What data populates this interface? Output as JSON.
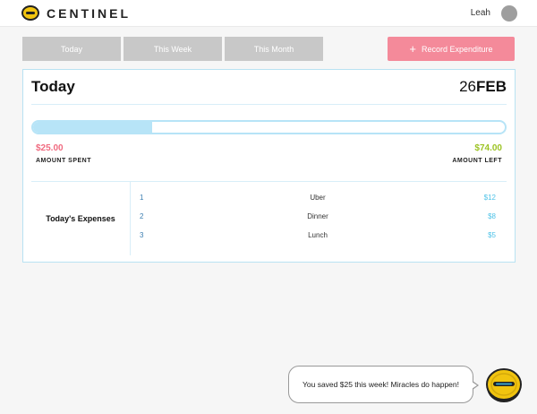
{
  "header": {
    "brand": "CENTINEL",
    "username": "Leah",
    "logo_icon": "coin-icon",
    "avatar_color": "#9e9e9e"
  },
  "tabs": [
    {
      "label": "Today"
    },
    {
      "label": "This Week"
    },
    {
      "label": "This Month"
    }
  ],
  "record_button": {
    "icon": "+",
    "label": "Record Expenditure",
    "color": "#f48a9a"
  },
  "card": {
    "title": "Today",
    "date_day": "26",
    "date_month": "FEB",
    "progress_fraction": 0.2525,
    "spent": {
      "value": "$25.00",
      "label": "AMOUNT SPENT",
      "color": "#f06b80"
    },
    "left": {
      "value": "$74.00",
      "label": "AMOUNT LEFT",
      "color": "#9cc324"
    },
    "expenses_heading": "Today's Expenses",
    "expenses": [
      {
        "num": "1",
        "name": "Uber",
        "amount": "$12"
      },
      {
        "num": "2",
        "name": "Dinner",
        "amount": "$8"
      },
      {
        "num": "3",
        "name": "Lunch",
        "amount": "$5"
      }
    ]
  },
  "bubble": {
    "message": "You saved $25 this week! Miracles do happen!"
  },
  "mascot_icon": "coin-mascot-icon"
}
